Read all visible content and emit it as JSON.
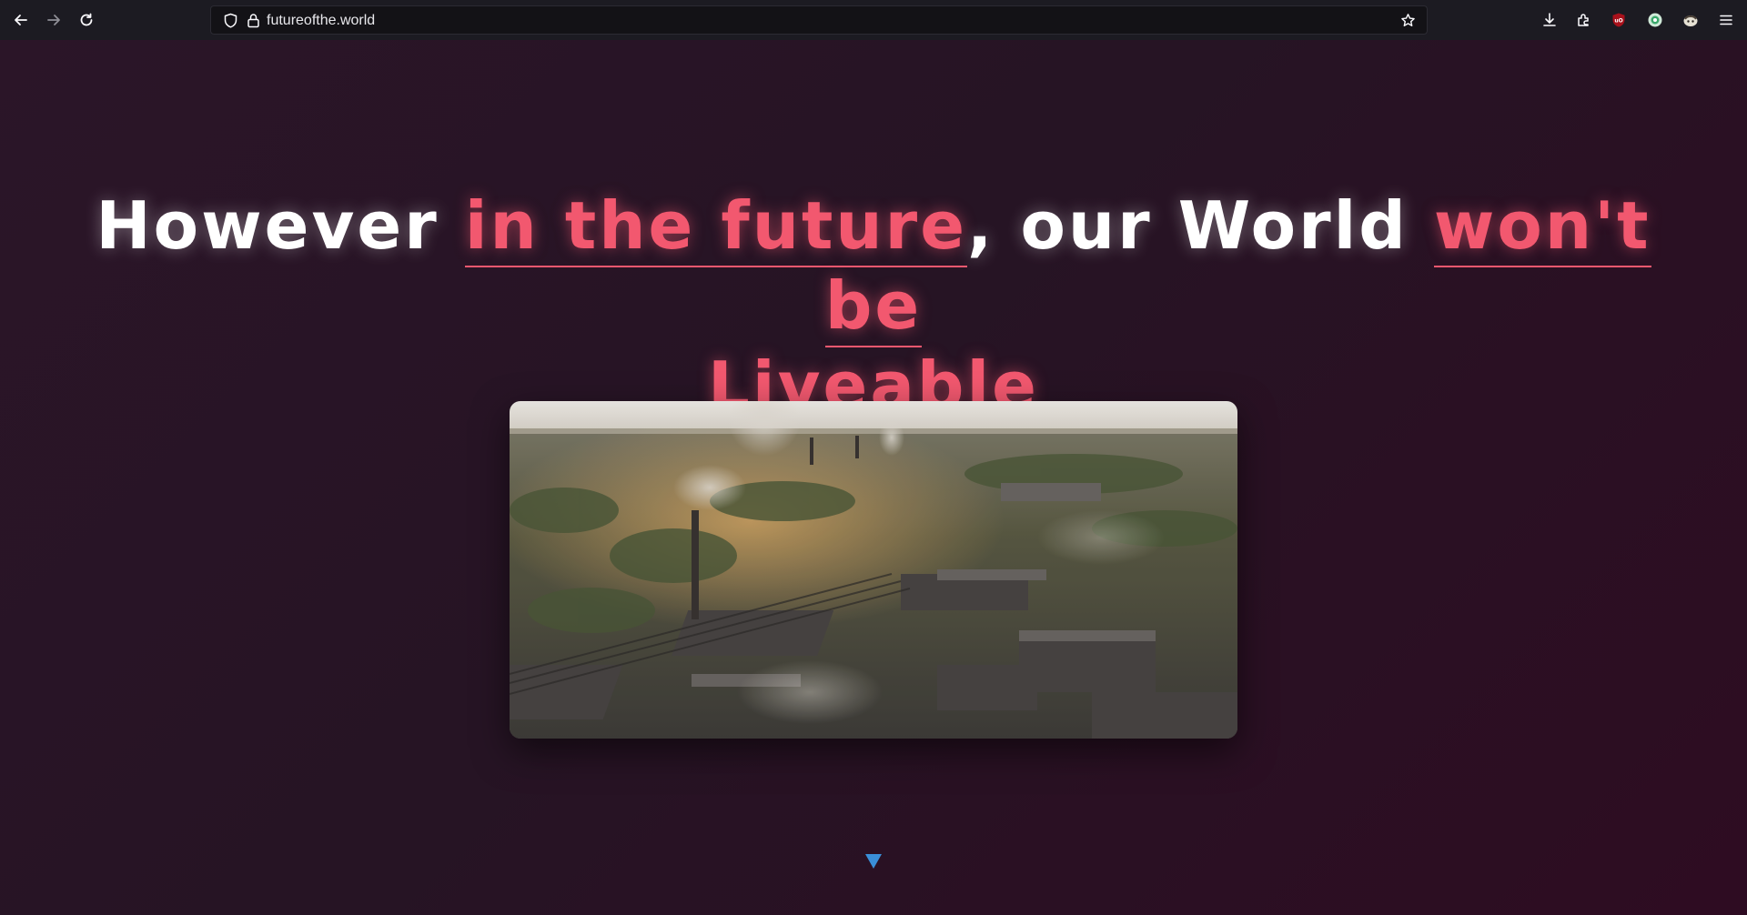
{
  "browser": {
    "url": "futureofthe.world",
    "icons": [
      "back-arrow-icon",
      "forward-arrow-icon",
      "reload-icon",
      "shield-icon",
      "lock-icon",
      "star-icon",
      "download-icon",
      "extensions-icon",
      "ublock-icon",
      "extension-globe-icon",
      "extension-avatar-icon",
      "menu-icon"
    ]
  },
  "hero": {
    "headline": {
      "part1": "However ",
      "highlight1": "in the future",
      "part2": ", our World ",
      "highlight2": "won't be",
      "highlight3": "Liveable"
    },
    "media": {
      "description_icon": "industrial-city-aerial-video",
      "type": "video"
    },
    "scroll_indicator_icon": "scroll-down-arrow-icon"
  },
  "colors": {
    "accent": "#f2586f",
    "background": "#241222",
    "toolbar": "#1c1b22",
    "scroll_arrow": "#3a8fd8"
  }
}
